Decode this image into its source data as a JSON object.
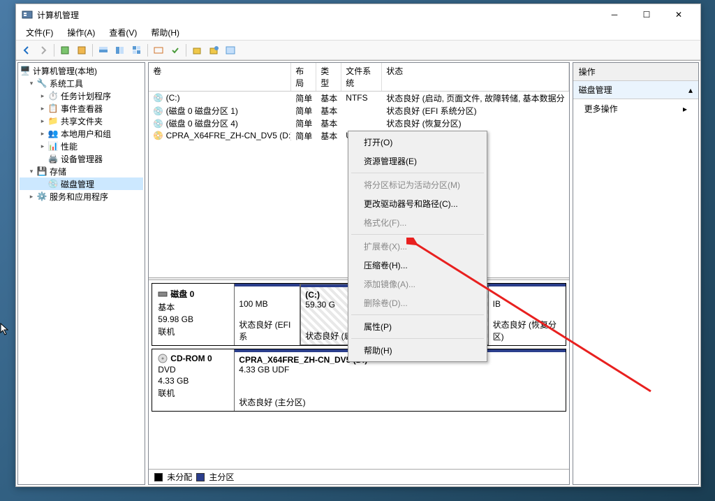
{
  "window": {
    "title": "计算机管理"
  },
  "menubar": {
    "file": "文件(F)",
    "operations": "操作(A)",
    "view": "查看(V)",
    "help": "帮助(H)"
  },
  "tree": {
    "root": "计算机管理(本地)",
    "system_tools": "系统工具",
    "task_scheduler": "任务计划程序",
    "event_viewer": "事件查看器",
    "shared_folders": "共享文件夹",
    "local_users": "本地用户和组",
    "performance": "性能",
    "device_manager": "设备管理器",
    "storage": "存储",
    "disk_management": "磁盘管理",
    "services": "服务和应用程序"
  },
  "columns": {
    "volume": "卷",
    "layout": "布局",
    "type": "类型",
    "filesystem": "文件系统",
    "status": "状态"
  },
  "volumes": [
    {
      "name": "(C:)",
      "layout": "简单",
      "type": "基本",
      "fs": "NTFS",
      "status": "状态良好 (启动, 页面文件, 故障转储, 基本数据分"
    },
    {
      "name": "(磁盘 0 磁盘分区 1)",
      "layout": "简单",
      "type": "基本",
      "fs": "",
      "status": "状态良好 (EFI 系统分区)"
    },
    {
      "name": "(磁盘 0 磁盘分区 4)",
      "layout": "简单",
      "type": "基本",
      "fs": "",
      "status": "状态良好 (恢复分区)"
    },
    {
      "name": "CPRA_X64FRE_ZH-CN_DV5 (D:)",
      "layout": "简单",
      "type": "基本",
      "fs": "UDF",
      "status": "状态良好 (主分区)"
    }
  ],
  "disk0": {
    "title": "磁盘 0",
    "type": "基本",
    "size": "59.98 GB",
    "state": "联机",
    "p1_size": "100 MB",
    "p1_status": "状态良好 (EFI 系",
    "p2_name": "(C:)",
    "p2_size": "59.30 G",
    "p2_status": "状态良好 (启动, 页面文件, 故障转储, 基本",
    "p3_size": "IB",
    "p3_status": "状态良好 (恢复分区)"
  },
  "cdrom": {
    "title": "CD-ROM 0",
    "type": "DVD",
    "size": "4.33 GB",
    "state": "联机",
    "p1_name": "CPRA_X64FRE_ZH-CN_DV5  (D:)",
    "p1_size": "4.33 GB UDF",
    "p1_status": "状态良好 (主分区)"
  },
  "legend": {
    "unallocated": "未分配",
    "primary": "主分区"
  },
  "actions": {
    "header": "操作",
    "section": "磁盘管理",
    "more": "更多操作"
  },
  "context": {
    "open": "打开(O)",
    "explorer": "资源管理器(E)",
    "mark_active": "将分区标记为活动分区(M)",
    "change_letter": "更改驱动器号和路径(C)...",
    "format": "格式化(F)...",
    "extend": "扩展卷(X)...",
    "shrink": "压缩卷(H)...",
    "add_mirror": "添加镜像(A)...",
    "delete": "删除卷(D)...",
    "properties": "属性(P)",
    "help": "帮助(H)"
  }
}
